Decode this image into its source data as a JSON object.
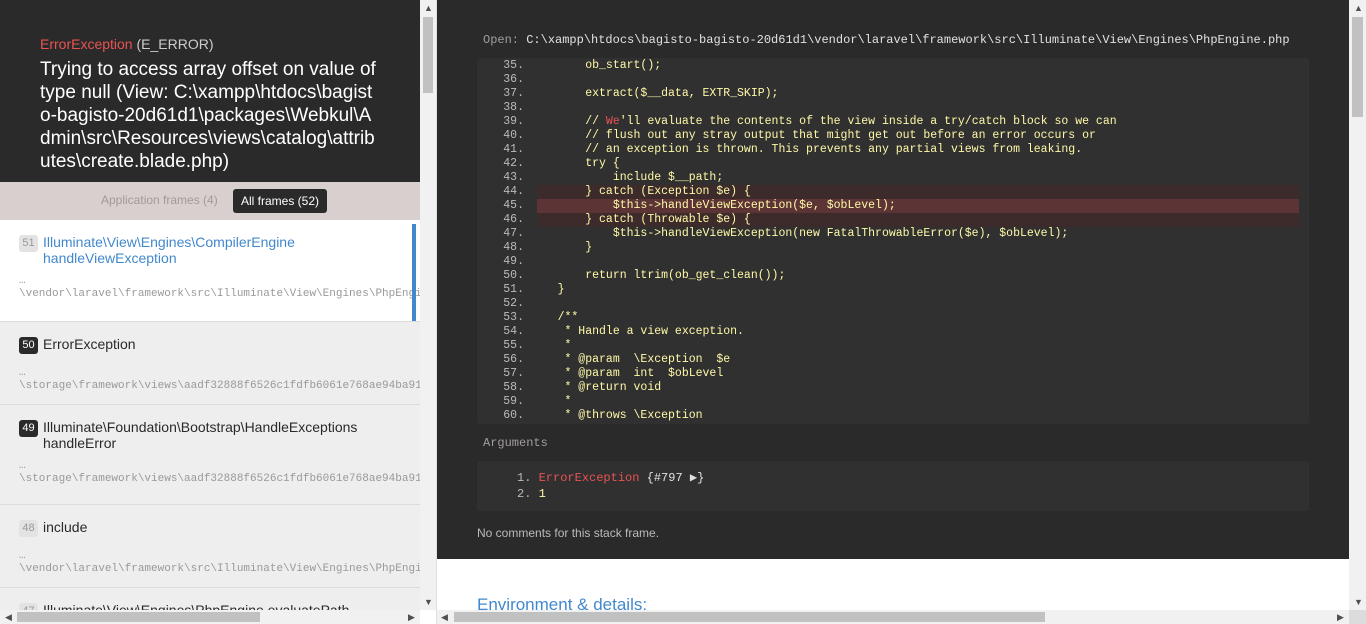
{
  "header": {
    "exception_class": "ErrorException",
    "exception_code": "(E_ERROR)",
    "message": "Trying to access array offset on value of type null (View: C:\\xampp\\htdocs\\bagisto-bagisto-20d61d1\\packages\\Webkul\\Admin\\src\\Resources\\views\\catalog\\attributes\\create.blade.php)"
  },
  "filters": {
    "application": "Application frames (4)",
    "all": "All frames (52)"
  },
  "frames": [
    {
      "num": "51",
      "class": "Illuminate\\View\\Engines\\CompilerEngine",
      "method": "handleViewException",
      "dots": "…",
      "path": "\\vendor\\laravel\\framework\\src\\Illuminate\\View\\Engines\\PhpEngine.php"
    },
    {
      "num": "50",
      "class": "ErrorException",
      "method": "",
      "dots": "…",
      "path": "\\storage\\framework\\views\\aadf32888f6526c1fdfb6061e768ae94ba91"
    },
    {
      "num": "49",
      "class": "Illuminate\\Foundation\\Bootstrap\\HandleExceptions",
      "method": "handleError",
      "dots": "…",
      "path": "\\storage\\framework\\views\\aadf32888f6526c1fdfb6061e768ae94ba91"
    },
    {
      "num": "48",
      "class": "include",
      "method": "",
      "dots": "…",
      "path": "\\vendor\\laravel\\framework\\src\\Illuminate\\View\\Engines\\PhpEngine.php"
    },
    {
      "num": "47",
      "class": "Illuminate\\View\\Engines\\PhpEngine evaluatePath",
      "method": "",
      "dots": "",
      "path": ""
    }
  ],
  "code": {
    "open_label": "Open:",
    "open_path": "C:\\xampp\\htdocs\\bagisto-bagisto-20d61d1\\vendor\\laravel\\framework\\src\\Illuminate\\View\\Engines\\PhpEngine.php",
    "lines": [
      {
        "n": "35.",
        "t": "        ob_start();"
      },
      {
        "n": "36.",
        "t": ""
      },
      {
        "n": "37.",
        "t": "        extract($__data, EXTR_SKIP);"
      },
      {
        "n": "38.",
        "t": ""
      },
      {
        "n": "39.",
        "t": "        // We'll evaluate the contents of the view inside a try/catch block so we can"
      },
      {
        "n": "40.",
        "t": "        // flush out any stray output that might get out before an error occurs or"
      },
      {
        "n": "41.",
        "t": "        // an exception is thrown. This prevents any partial views from leaking."
      },
      {
        "n": "42.",
        "t": "        try {"
      },
      {
        "n": "43.",
        "t": "            include $__path;"
      },
      {
        "n": "44.",
        "t": "        } catch (Exception $e) {"
      },
      {
        "n": "45.",
        "t": "            $this->handleViewException($e, $obLevel);"
      },
      {
        "n": "46.",
        "t": "        } catch (Throwable $e) {"
      },
      {
        "n": "47.",
        "t": "            $this->handleViewException(new FatalThrowableError($e), $obLevel);"
      },
      {
        "n": "48.",
        "t": "        }"
      },
      {
        "n": "49.",
        "t": ""
      },
      {
        "n": "50.",
        "t": "        return ltrim(ob_get_clean());"
      },
      {
        "n": "51.",
        "t": "    }"
      },
      {
        "n": "52.",
        "t": ""
      },
      {
        "n": "53.",
        "t": "    /**"
      },
      {
        "n": "54.",
        "t": "     * Handle a view exception."
      },
      {
        "n": "55.",
        "t": "     *"
      },
      {
        "n": "56.",
        "t": "     * @param  \\Exception  $e"
      },
      {
        "n": "57.",
        "t": "     * @param  int  $obLevel"
      },
      {
        "n": "58.",
        "t": "     * @return void"
      },
      {
        "n": "59.",
        "t": "     *"
      },
      {
        "n": "60.",
        "t": "     * @throws \\Exception"
      }
    ]
  },
  "arguments": {
    "label": "Arguments",
    "items": [
      {
        "idx": "1.",
        "class": "ErrorException",
        "ref": "{#797 ▶}"
      },
      {
        "idx": "2.",
        "value": "1"
      }
    ]
  },
  "comments": "No comments for this stack frame.",
  "environment_title": "Environment & details:"
}
